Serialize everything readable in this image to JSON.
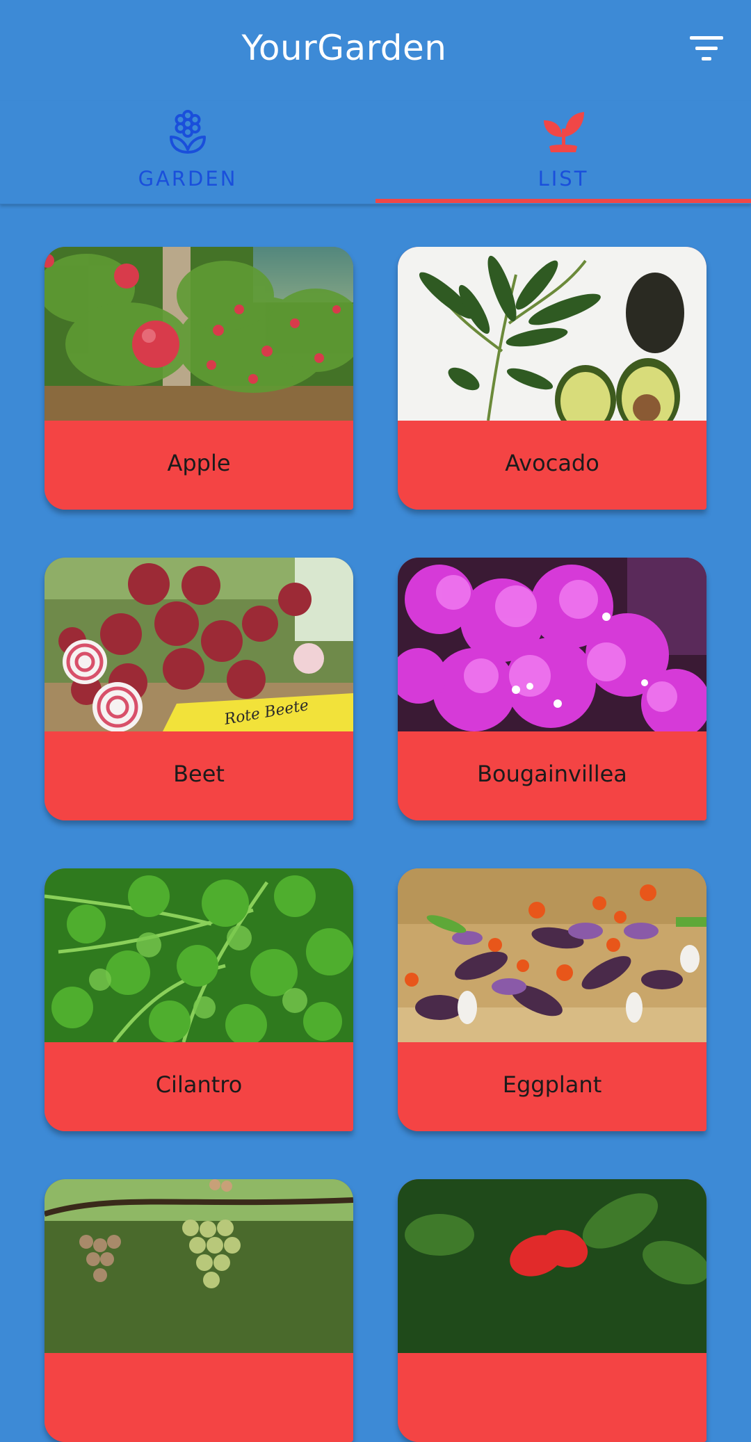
{
  "app": {
    "title": "YourGarden"
  },
  "tabs": [
    {
      "label": "GARDEN",
      "icon": "flower-icon",
      "selected": false
    },
    {
      "label": "LIST",
      "icon": "sprout-icon",
      "selected": true
    }
  ],
  "toolbar": {
    "filter_icon": "filter-icon"
  },
  "colors": {
    "background": "#3d8ad6",
    "accent": "#f04747",
    "tab_label": "#1a4fdb",
    "card_label_bg": "#f44444"
  },
  "plants": [
    {
      "name": "Apple",
      "image": "apple-orchard-photo"
    },
    {
      "name": "Avocado",
      "image": "avocado-photo"
    },
    {
      "name": "Beet",
      "image": "beet-photo"
    },
    {
      "name": "Bougainvillea",
      "image": "bougainvillea-photo"
    },
    {
      "name": "Cilantro",
      "image": "cilantro-photo"
    },
    {
      "name": "Eggplant",
      "image": "eggplant-photo"
    },
    {
      "name": "",
      "image": "grapes-photo"
    },
    {
      "name": "",
      "image": "hibiscus-photo"
    }
  ]
}
